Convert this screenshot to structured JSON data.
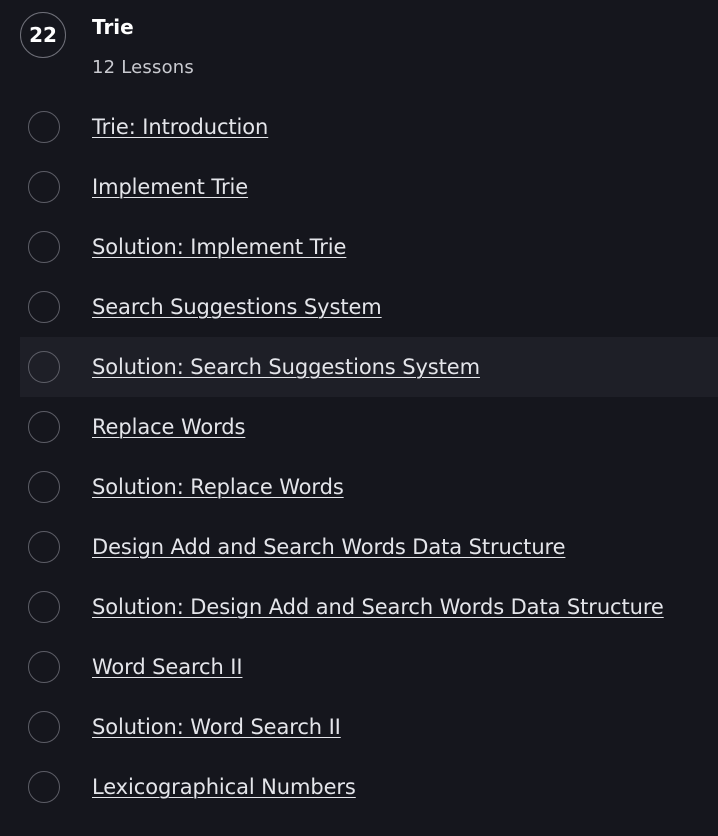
{
  "module": {
    "number": "22",
    "title": "Trie",
    "lesson_count": "12 Lessons"
  },
  "lessons": [
    {
      "title": "Trie: Introduction"
    },
    {
      "title": "Implement Trie"
    },
    {
      "title": "Solution: Implement Trie"
    },
    {
      "title": "Search Suggestions System"
    },
    {
      "title": "Solution: Search Suggestions System"
    },
    {
      "title": "Replace Words"
    },
    {
      "title": "Solution: Replace Words"
    },
    {
      "title": "Design Add and Search Words Data Structure"
    },
    {
      "title": "Solution: Design Add and Search Words Data Structure"
    },
    {
      "title": "Word Search II"
    },
    {
      "title": "Solution: Word Search II"
    },
    {
      "title": "Lexicographical Numbers"
    }
  ],
  "colors": {
    "background": "#15161d",
    "hover_row": "#1e1f27",
    "text": "#e4e5ea",
    "circle_border": "#5c5d66"
  }
}
